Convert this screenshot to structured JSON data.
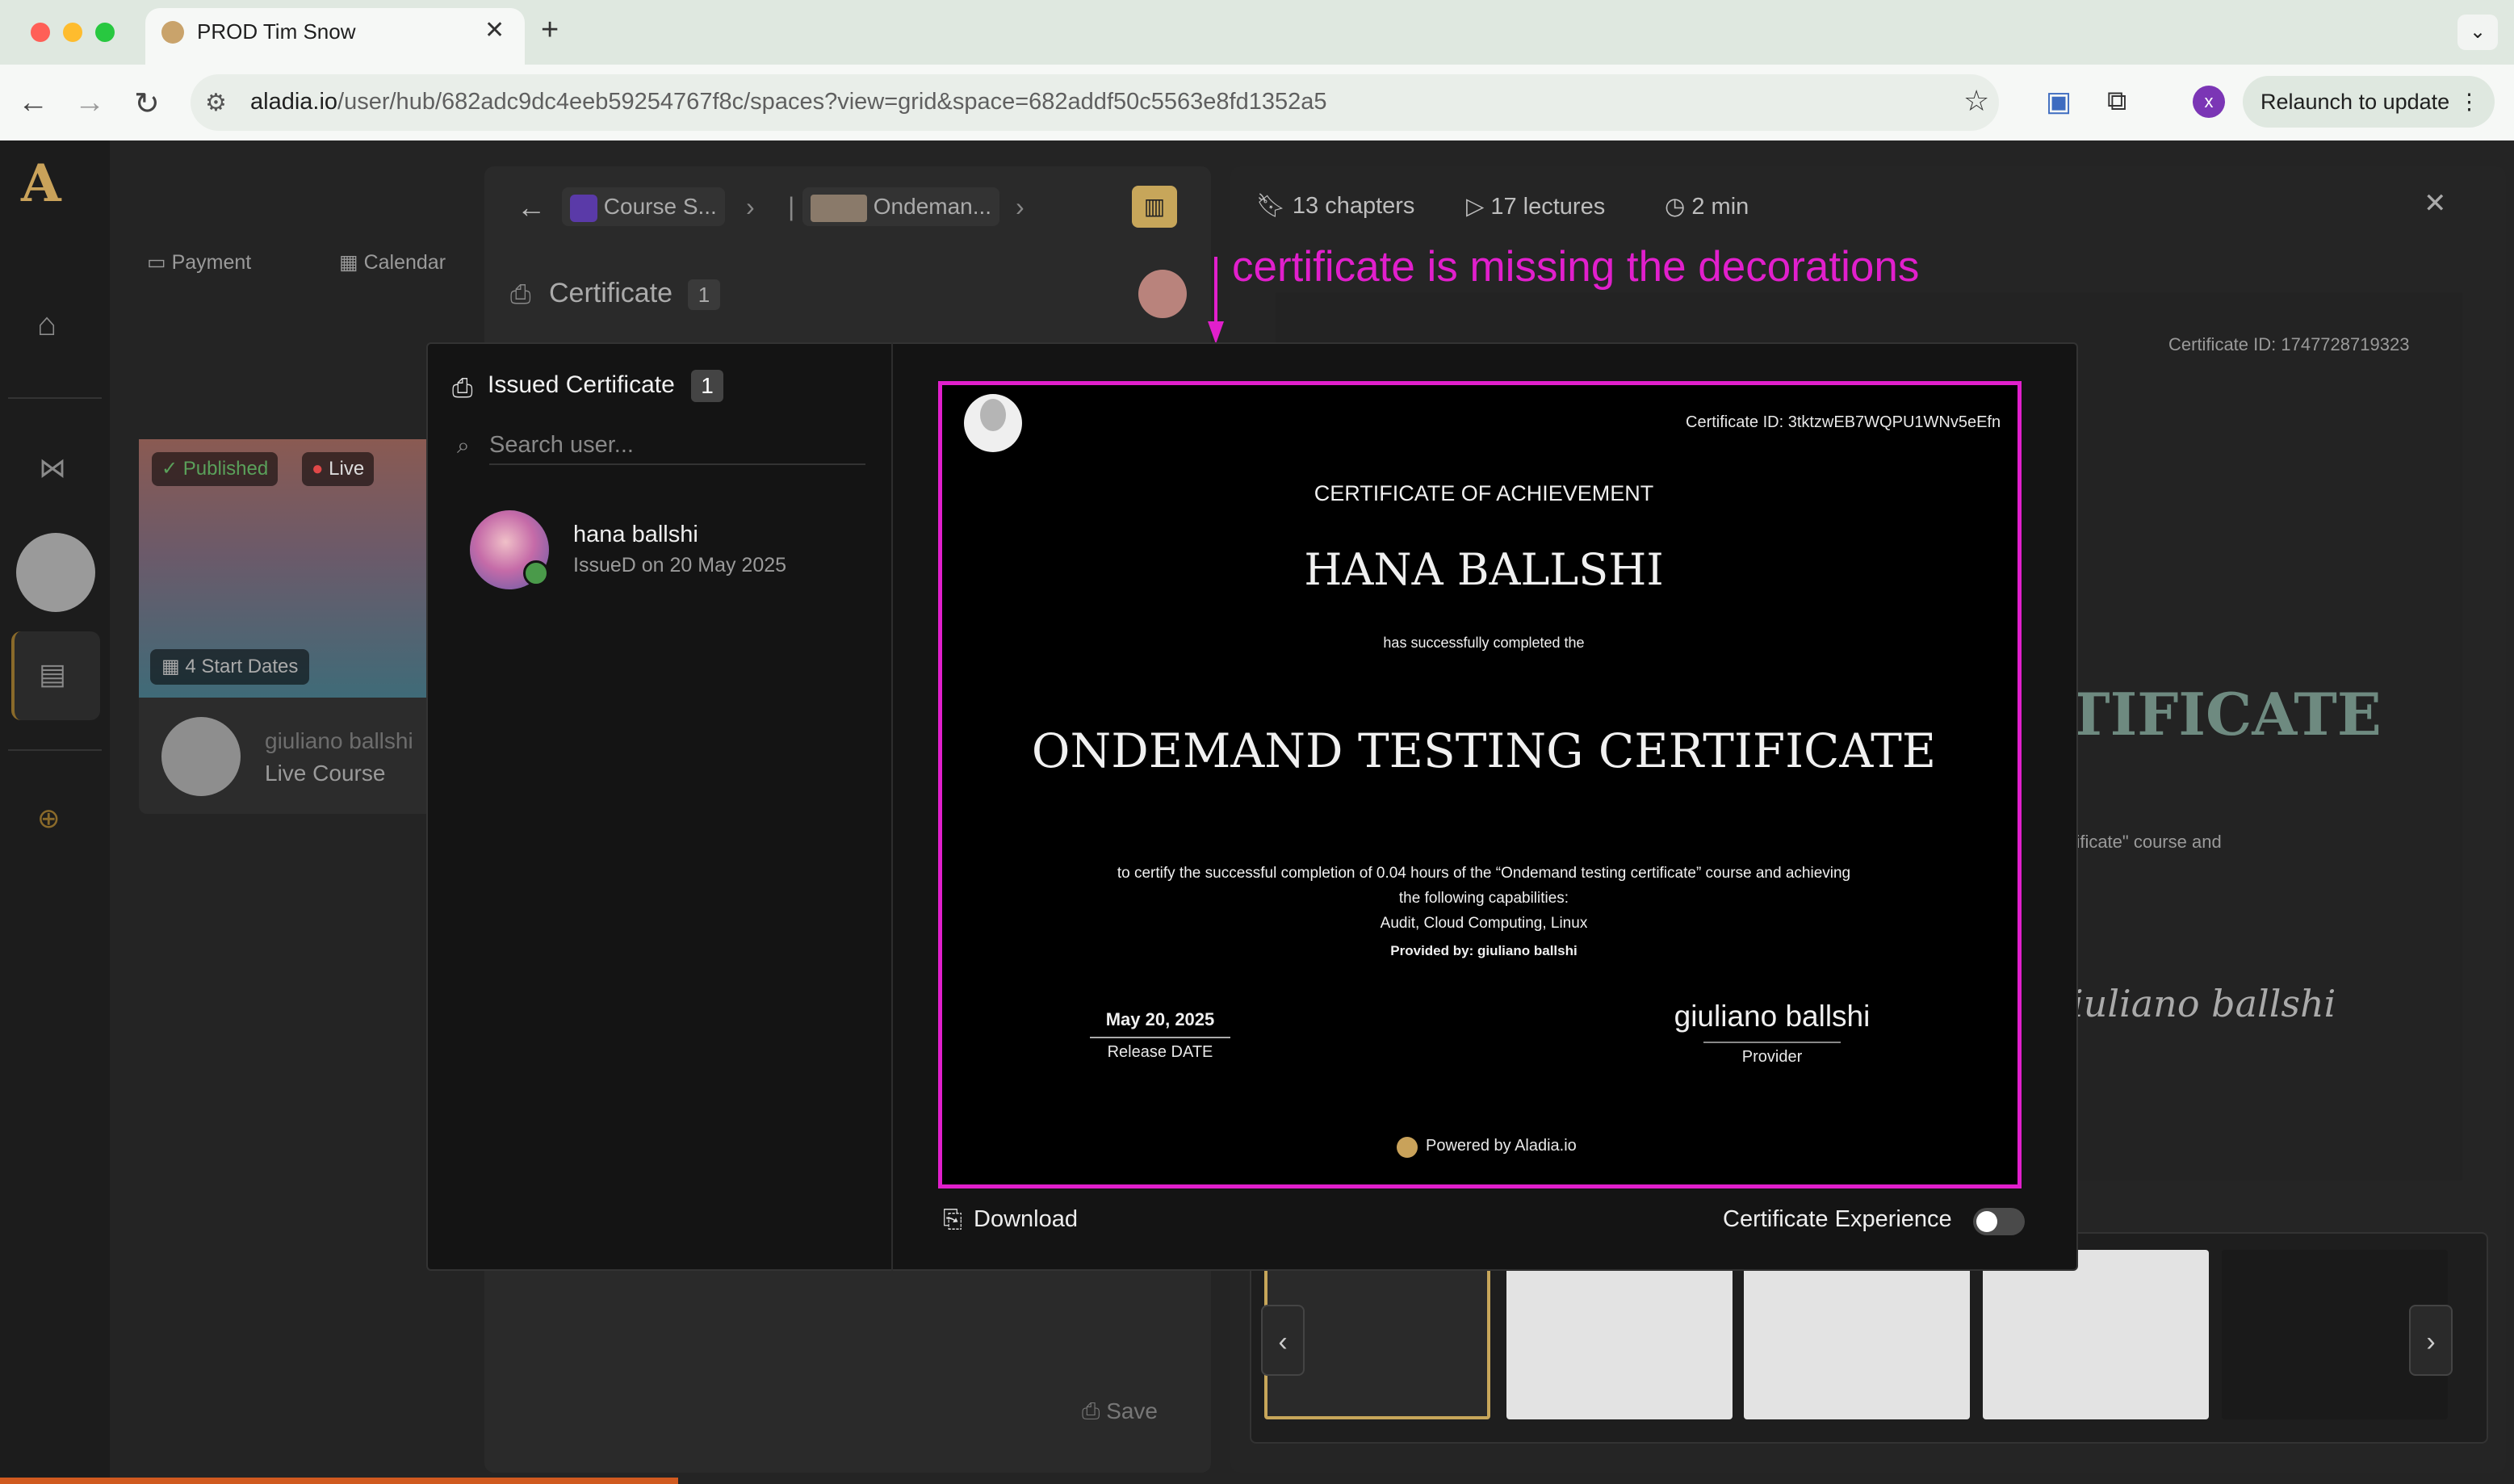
{
  "browser": {
    "tab_title": "PROD Tim Snow",
    "tab_close": "✕",
    "new_tab": "+",
    "url_host": "aladia.io",
    "url_path": "/user/hub/682adc9dc4eeb59254767f8c/spaces?view=grid&space=682addf50c5563e8fd1352a5",
    "profile_initial": "x",
    "relaunch_label": "Relaunch to update"
  },
  "topnav": {
    "payment": "Payment",
    "calendar": "Calendar"
  },
  "course_card": {
    "published": "Published",
    "live": "Live",
    "start_dates": "4 Start Dates",
    "owner": "giuliano ballshi",
    "type": "Live Course"
  },
  "mid_panel": {
    "crumb_1": "Course S...",
    "crumb_2": "Ondeman...",
    "section": "Certificate",
    "section_count": "1",
    "save": "Save"
  },
  "right_panel": {
    "chapters": "13  chapters",
    "lectures": "17 lectures",
    "duration": "2 min",
    "certificate_id": "Certificate ID: 1747728719323",
    "big_title": "TIFICATE",
    "course_line": "rtificate\" course and",
    "signature": "iuliano ballshi"
  },
  "annotation": "certificate is missing the decorations",
  "modal": {
    "title": "Issued Certificate",
    "count": "1",
    "search_placeholder": "Search user...",
    "user_name": "hana ballshi",
    "user_issued": "IssueD on 20 May 2025",
    "download": "Download",
    "experience": "Certificate Experience"
  },
  "certificate": {
    "id": "Certificate ID: 3tktzwEB7WQPU1WNv5eEfn",
    "heading": "CERTIFICATE OF ACHIEVEMENT",
    "recipient": "HANA BALLSHI",
    "completed": "has successfully completed the",
    "course": "ONDEMAND TESTING CERTIFICATE",
    "desc_line1": "to certify the successful completion of 0.04 hours of the “Ondemand testing certificate” course and achieving",
    "desc_line2": "the following capabilities:",
    "capabilities": "Audit, Cloud Computing, Linux",
    "provided_by": "Provided by: giuliano ballshi",
    "date": "May 20, 2025",
    "date_label": "Release DATE",
    "signature": "giuliano ballshi",
    "signature_label": "Provider",
    "powered": "Powered by Aladia.io"
  },
  "colors": {
    "annotation": "#e11fcc",
    "accent_gold": "#c7a65a",
    "published_green": "#5aa05a",
    "live_red": "#e04848"
  }
}
